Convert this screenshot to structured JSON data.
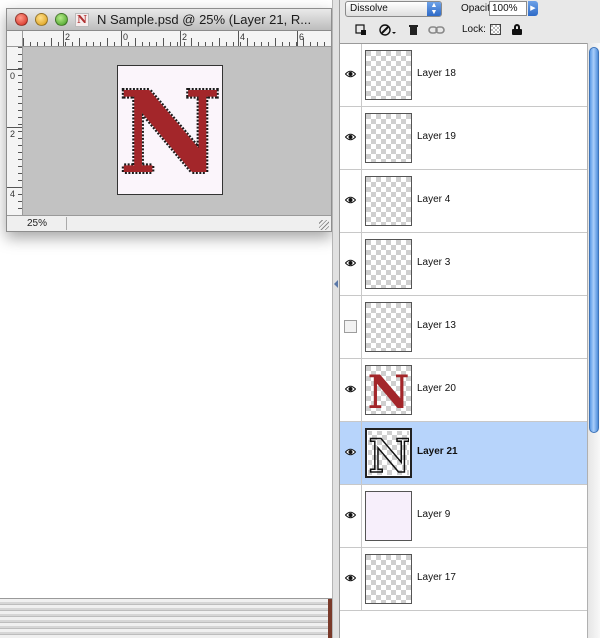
{
  "document": {
    "title": "N Sample.psd @ 25% (Layer 21, R...",
    "doc_icon_letter": "N",
    "zoom": "25%",
    "ruler_h_labels": [
      "2",
      "0",
      "2",
      "4",
      "6"
    ],
    "ruler_v_labels": [
      "0",
      "2",
      "4"
    ],
    "canvas_glyph": "N",
    "colors": {
      "letter_fill": "#a3262a",
      "letter_outline": "#1a1a1a",
      "canvas_bg": "#fbf5fb"
    }
  },
  "layers_panel": {
    "blend_mode": "Dissolve",
    "opacity_label": "Opacity:",
    "opacity_value": "100%",
    "lock_label": "Lock:",
    "toolbar_icons": [
      "lock-pixels-icon",
      "brush-icon",
      "trash-icon",
      "link-icon"
    ],
    "layers": [
      {
        "name": "Layer 18",
        "visible": true,
        "thumb": "transparent",
        "selected": false
      },
      {
        "name": "Layer 19",
        "visible": true,
        "thumb": "transparent",
        "selected": false
      },
      {
        "name": "Layer 4",
        "visible": true,
        "thumb": "transparent",
        "selected": false
      },
      {
        "name": "Layer 3",
        "visible": true,
        "thumb": "transparent",
        "selected": false
      },
      {
        "name": "Layer 13",
        "visible": false,
        "thumb": "transparent",
        "selected": false
      },
      {
        "name": "Layer 20",
        "visible": true,
        "thumb": "red-n",
        "glyph": "N",
        "selected": false
      },
      {
        "name": "Layer 21",
        "visible": true,
        "thumb": "outline-n",
        "glyph": "N",
        "selected": true
      },
      {
        "name": "Layer 9",
        "visible": true,
        "thumb": "pale",
        "selected": false
      },
      {
        "name": "Layer 17",
        "visible": true,
        "thumb": "transparent",
        "selected": false
      }
    ],
    "colors": {
      "selection": "#b7d4fb",
      "accent": "#2e6ac7"
    }
  }
}
